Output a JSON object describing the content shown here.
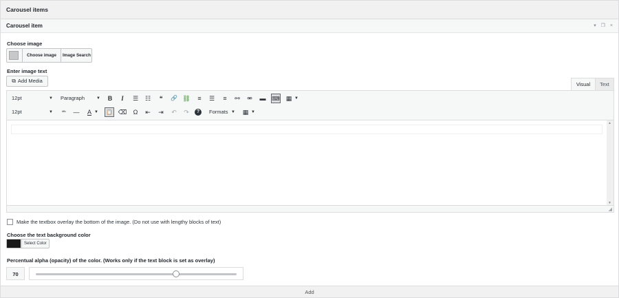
{
  "panel": {
    "title": "Carousel items"
  },
  "item": {
    "title": "Carousel item",
    "tools": {
      "collapse": "▾",
      "copy": "❐",
      "remove": "×"
    }
  },
  "image": {
    "label": "Choose image",
    "choose_label": "Choose image",
    "search_label": "Image Search",
    "thumb_icon": "image-placeholder-icon"
  },
  "text": {
    "label": "Enter image text",
    "add_media_label": "Add Media",
    "add_media_icon": "media-icon",
    "tabs": [
      {
        "label": "Visual",
        "active": true
      },
      {
        "label": "Text",
        "active": false
      }
    ],
    "toolbar_row1": {
      "font_size": "12pt",
      "format": "Paragraph",
      "buttons": [
        {
          "name": "bold-icon",
          "glyph": "B"
        },
        {
          "name": "italic-icon",
          "glyph": "I"
        },
        {
          "name": "bullet-list-icon",
          "glyph": "☰"
        },
        {
          "name": "numbered-list-icon",
          "glyph": "☷"
        },
        {
          "name": "blockquote-icon",
          "glyph": "❝"
        },
        {
          "name": "link-icon",
          "glyph": "🔗"
        },
        {
          "name": "unlink-icon",
          "glyph": "⛓"
        },
        {
          "name": "align-left-icon",
          "glyph": "≡"
        },
        {
          "name": "align-center-icon",
          "glyph": "☰"
        },
        {
          "name": "align-right-icon",
          "glyph": "≡"
        },
        {
          "name": "insert-link-icon",
          "glyph": "⚯"
        },
        {
          "name": "remove-link-icon",
          "glyph": "⚮"
        },
        {
          "name": "read-more-icon",
          "glyph": "▬"
        },
        {
          "name": "toolbar-toggle-icon",
          "glyph": "⌨"
        },
        {
          "name": "grid-icon",
          "glyph": "▦"
        }
      ]
    },
    "toolbar_row2": {
      "font_size": "12pt",
      "buttons": [
        {
          "name": "strikethrough-icon",
          "glyph": "ᴬᴮᶜ"
        },
        {
          "name": "horizontal-line-icon",
          "glyph": "—"
        },
        {
          "name": "text-color-icon",
          "glyph": "A"
        },
        {
          "name": "paste-text-icon",
          "glyph": "📋"
        },
        {
          "name": "clear-formatting-icon",
          "glyph": "⌫"
        },
        {
          "name": "special-character-icon",
          "glyph": "Ω"
        },
        {
          "name": "outdent-icon",
          "glyph": "⇤"
        },
        {
          "name": "indent-icon",
          "glyph": "⇥"
        },
        {
          "name": "undo-icon",
          "glyph": "↶"
        },
        {
          "name": "redo-icon",
          "glyph": "↷"
        },
        {
          "name": "help-icon",
          "glyph": "?"
        }
      ],
      "formats_label": "Formats",
      "table_icon": "table-icon"
    },
    "content": ""
  },
  "overlay": {
    "checked": false,
    "label": "Make the textbox overlay the bottom of the image. (Do not use with lengthy blocks of text)"
  },
  "bg_color": {
    "label": "Choose the text background color",
    "value": "#1a1a1a",
    "button_label": "Select Color"
  },
  "alpha": {
    "label": "Percentual alpha (opacity) of the color. (Works only if the text block is set as overlay)",
    "value": "70",
    "min": 0,
    "max": 100
  },
  "footer": {
    "add_label": "Add"
  }
}
